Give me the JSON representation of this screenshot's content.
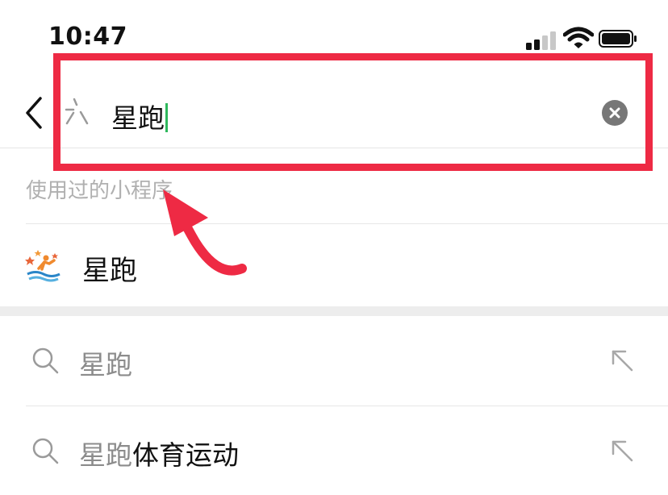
{
  "status_bar": {
    "time": "10:47"
  },
  "search": {
    "query": "星跑"
  },
  "section": {
    "label": "使用过的小程序"
  },
  "mini_programs": [
    {
      "name": "星跑"
    }
  ],
  "suggestions": [
    {
      "highlight": "星跑",
      "rest": ""
    },
    {
      "highlight": "星跑",
      "rest": "体育运动"
    }
  ],
  "colors": {
    "accent_caret": "#2eb85c",
    "annotation_red": "#ee2a44",
    "muted_text": "#b0b0b0",
    "highlight_text": "#8c8c8c"
  },
  "icons": {
    "back": "chevron-left-icon",
    "mini_program": "mini-program-icon",
    "clear": "clear-icon",
    "search": "search-icon",
    "fill": "arrow-up-left-icon"
  }
}
